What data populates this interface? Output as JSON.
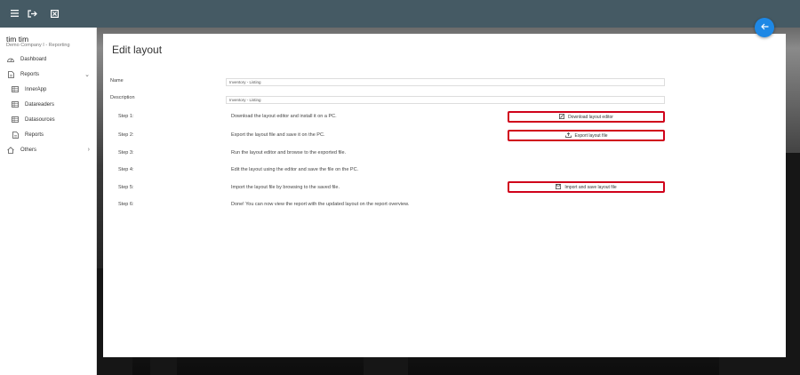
{
  "topbar": {
    "icons": [
      "menu-icon",
      "logout-icon",
      "close-box-icon"
    ]
  },
  "user": {
    "name": "tim tim",
    "company": "Demo Company I - Reporting"
  },
  "sidebar": {
    "items": [
      {
        "label": "Dashboard",
        "icon": "dashboard-icon"
      },
      {
        "label": "Reports",
        "icon": "document-icon",
        "expanded": true
      },
      {
        "label": "InnerApp",
        "icon": "table-icon"
      },
      {
        "label": "Datareaders",
        "icon": "table-icon"
      },
      {
        "label": "Datasources",
        "icon": "table-icon"
      },
      {
        "label": "Reports",
        "icon": "document-icon"
      },
      {
        "label": "Others",
        "icon": "house-icon"
      }
    ]
  },
  "main": {
    "title": "Edit layout",
    "name_label": "Name",
    "name_value": "Inventory - Listing",
    "description_label": "Description",
    "description_value": "Inventory - Listing",
    "steps": [
      {
        "label": "Step 1:",
        "text": "Download the layout editor and install it on a PC.",
        "button": "Download layout editor"
      },
      {
        "label": "Step 2:",
        "text": "Export the layout file and save it on the PC.",
        "button": "Export layout file"
      },
      {
        "label": "Step 3:",
        "text": "Run the layout editor and browse to the exported file."
      },
      {
        "label": "Step 4:",
        "text": "Edit the layout using the editor and save the file on the PC."
      },
      {
        "label": "Step 5:",
        "text": "Import the layout file by browsing to the saved file.",
        "button": "Import and save layout file"
      },
      {
        "label": "Step 6:",
        "text": "Done! You can now view the report with the updated layout on the report overview."
      }
    ]
  },
  "colors": {
    "topbar": "#455a64",
    "highlight": "#d0021b",
    "fab": "#1e88e5"
  }
}
